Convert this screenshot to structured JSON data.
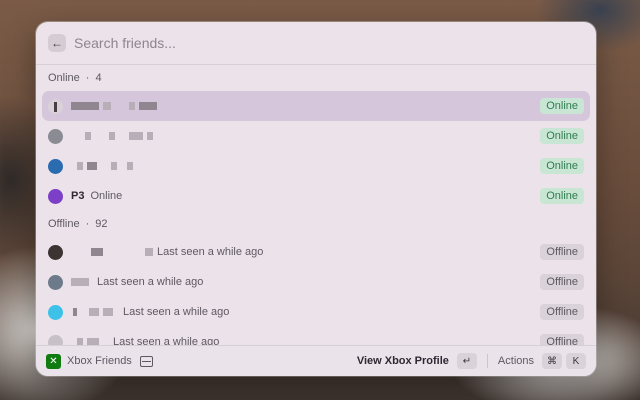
{
  "search": {
    "placeholder": "Search friends..."
  },
  "sections": {
    "online": {
      "title": "Online",
      "count": "4"
    },
    "offline": {
      "title": "Offline",
      "count": "92"
    }
  },
  "online_rows": [
    {
      "status": "Online",
      "avatar_color": "#d9d2d8"
    },
    {
      "status": "Online",
      "avatar_color": "#8b8b93"
    },
    {
      "status": "Online",
      "avatar_color": "#2b6cb0"
    },
    {
      "name": "P3",
      "subtitle": "Online",
      "status": "Online",
      "avatar_color": "#7d3fc7"
    }
  ],
  "offline_rows": [
    {
      "subtitle": "Last seen a while ago",
      "status": "Offline",
      "avatar_color": "#3b3433"
    },
    {
      "subtitle": "Last seen a while ago",
      "status": "Offline",
      "avatar_color": "#6c7a8a"
    },
    {
      "subtitle": "Last seen a while ago",
      "status": "Offline",
      "avatar_color": "#3ec1e8"
    },
    {
      "subtitle": "Last seen a while ago",
      "status": "Offline",
      "avatar_color": "#c7c0c6"
    }
  ],
  "footer": {
    "extension_name": "Xbox Friends",
    "primary_action": "View Xbox Profile",
    "enter_key": "↵",
    "actions_label": "Actions",
    "cmd_key": "⌘",
    "k_key": "K"
  }
}
